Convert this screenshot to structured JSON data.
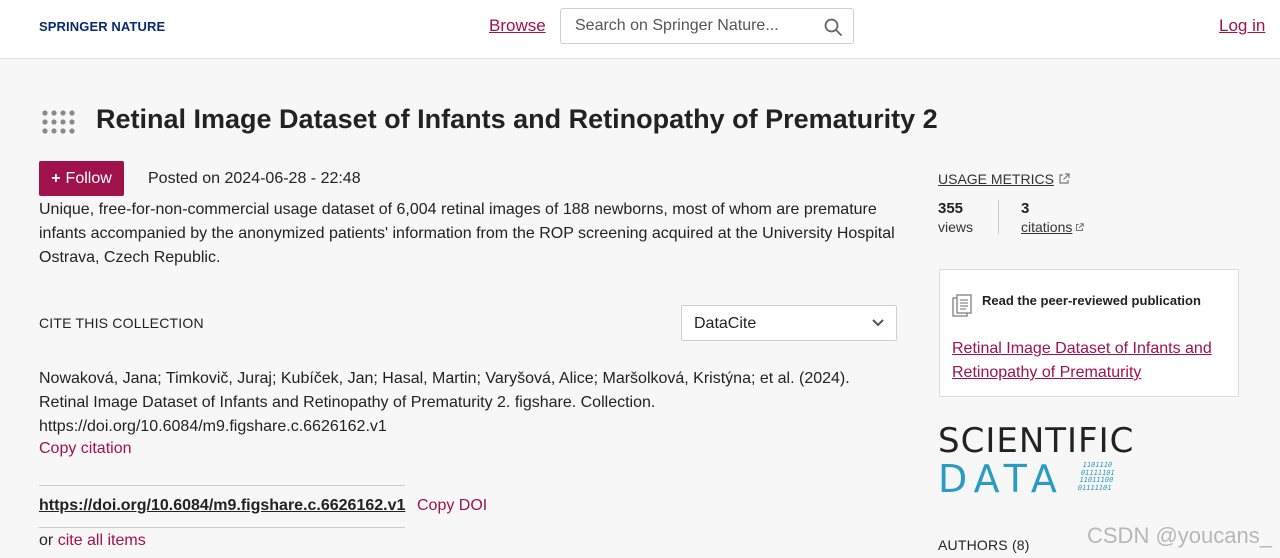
{
  "header": {
    "logo_text": "SPRINGER NATURE",
    "browse_label": "Browse",
    "search_placeholder": "Search on Springer Nature...",
    "login_label": "Log in"
  },
  "page": {
    "title": "Retinal Image Dataset of Infants and Retinopathy of Prematurity 2",
    "follow_label": "Follow",
    "posted": "Posted on 2024-06-28 - 22:48",
    "description": "Unique, free-for-non-commercial usage dataset of 6,004 retinal images of 188 newborns, most of whom are premature infants accompanied by the anonymized patients' information from the ROP screening acquired at the University Hospital Ostrava, Czech Republic."
  },
  "cite": {
    "label": "CITE THIS COLLECTION",
    "format_selected": "DataCite",
    "citation_text": "Nowaková, Jana; Timkovič, Juraj; Kubíček, Jan; Hasal, Martin; Varyšová, Alice; Maršolková, Kristýna; et al. (2024). Retinal Image Dataset of Infants and Retinopathy of Prematurity 2. figshare. Collection. https://doi.org/10.6084/m9.figshare.c.6626162.v1",
    "copy_citation_label": "Copy citation",
    "doi_link": "https://doi.org/10.6084/m9.figshare.c.6626162.v1",
    "copy_doi_label": "Copy DOI",
    "cite_all_prefix": "or",
    "cite_all_label": "cite all items"
  },
  "metrics": {
    "usage_label": "USAGE METRICS",
    "views_value": "355",
    "views_label": "views",
    "citations_value": "3",
    "citations_label": "citations"
  },
  "publication": {
    "heading": "Read the peer-reviewed publication",
    "link_text": "Retinal Image Dataset of Infants and Retinopathy of Prematurity"
  },
  "journal_logo": {
    "line1": "SCIENTIFIC",
    "line2": "DATA",
    "binary": [
      "1101110",
      "01111101",
      "11011100",
      "01111101"
    ]
  },
  "authors_label": "AUTHORS (8)",
  "watermark": "CSDN @youcans_",
  "colors": {
    "accent": "#a0124a",
    "logo_blue": "#0b2a6b",
    "sd_blue": "#2a9bc4"
  },
  "icons": [
    "search-icon",
    "dots-grid-icon",
    "chevron-down-icon",
    "external-link-icon",
    "document-stack-icon"
  ]
}
